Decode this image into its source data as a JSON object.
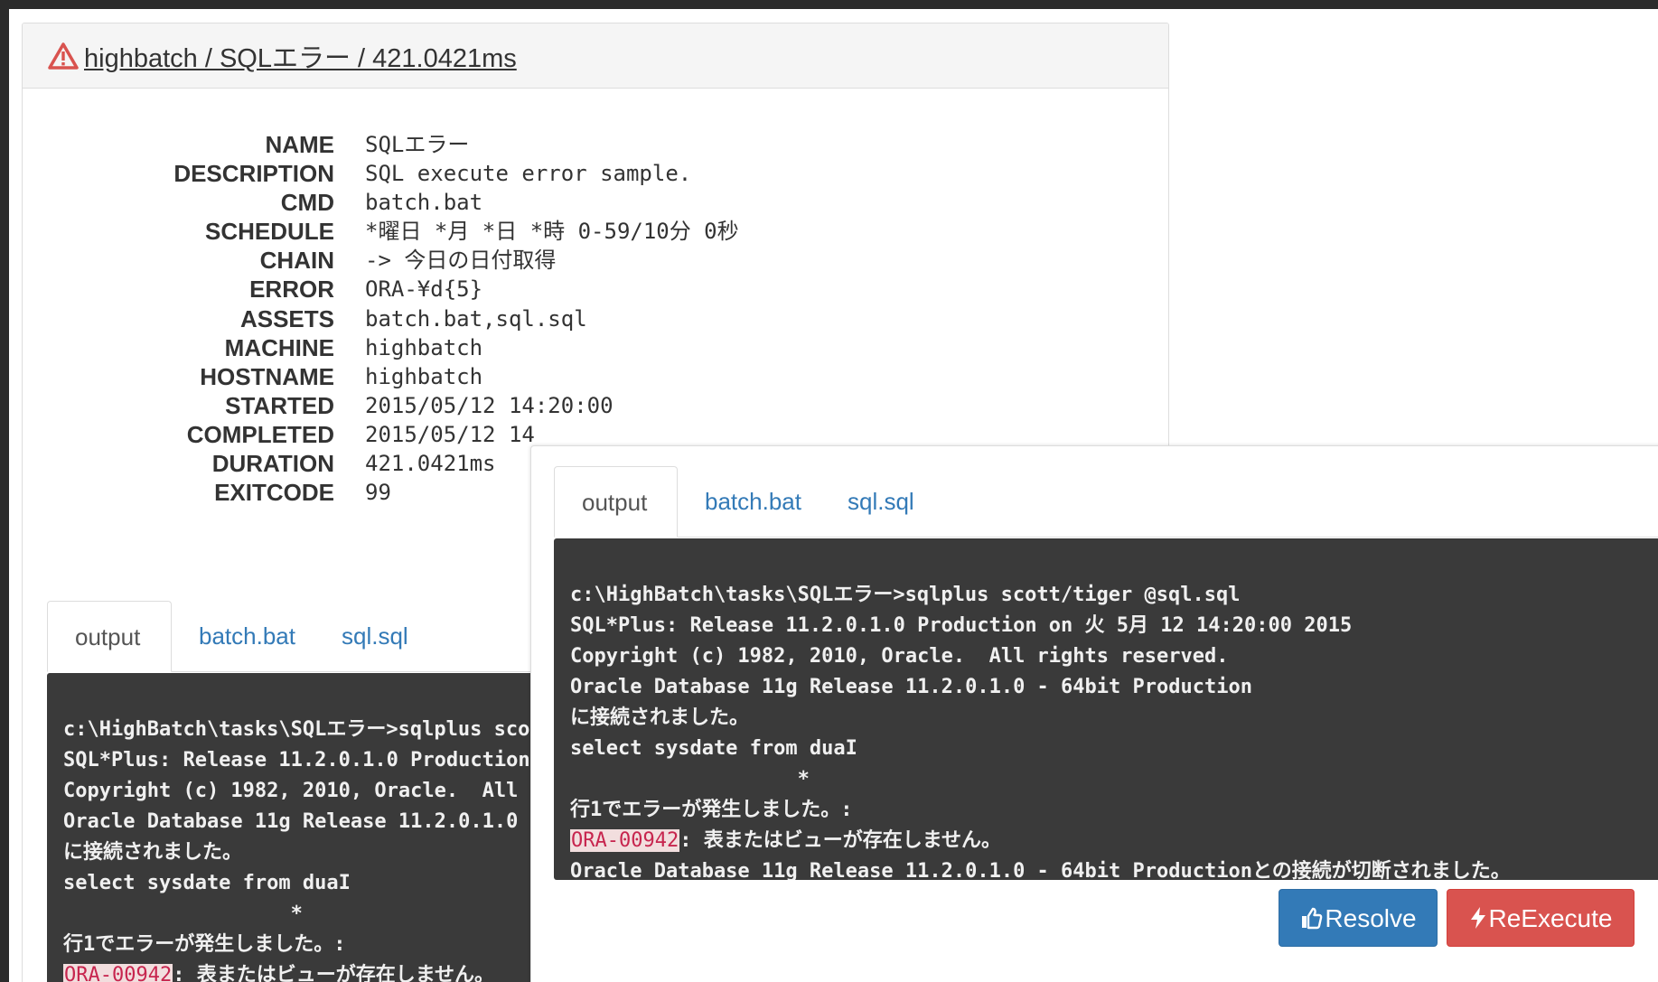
{
  "header": {
    "title": "highbatch / SQLエラー / 421.0421ms",
    "icon": "warning-icon",
    "icon_color": "#d9534f"
  },
  "details": [
    {
      "label": "NAME",
      "value": "SQLエラー"
    },
    {
      "label": "DESCRIPTION",
      "value": "SQL execute error sample."
    },
    {
      "label": "CMD",
      "value": "batch.bat"
    },
    {
      "label": "SCHEDULE",
      "value": "*曜日 *月 *日 *時 0-59/10分 0秒"
    },
    {
      "label": "CHAIN",
      "value": "-> 今日の日付取得"
    },
    {
      "label": "ERROR",
      "value": "ORA-¥d{5}"
    },
    {
      "label": "ASSETS",
      "value": "batch.bat,sql.sql"
    },
    {
      "label": "MACHINE",
      "value": "highbatch"
    },
    {
      "label": "HOSTNAME",
      "value": "highbatch"
    },
    {
      "label": "STARTED",
      "value": "2015/05/12 14:20:00"
    },
    {
      "label": "COMPLETED",
      "value": "2015/05/12 14"
    },
    {
      "label": "DURATION",
      "value": "421.0421ms"
    },
    {
      "label": "EXITCODE",
      "value": "99"
    }
  ],
  "tabs": [
    {
      "label": "output",
      "active": true
    },
    {
      "label": "batch.bat",
      "active": false
    },
    {
      "label": "sql.sql",
      "active": false
    }
  ],
  "console": {
    "lines": [
      "c:\\HighBatch\\tasks\\SQLエラー>sqlplus scott/tiger @sql.sql",
      "SQL*Plus: Release 11.2.0.1.0 Production on 火 5月 12 14:20:00 2015",
      "Copyright (c) 1982, 2010, Oracle.  All rights reserved.",
      "Oracle Database 11g Release 11.2.0.1.0 - 64bit Production",
      "に接続されました。",
      "select sysdate from duaI",
      "                   *",
      "行1でエラーが発生しました。:"
    ],
    "error_code": "ORA-00942",
    "error_message": ": 表またはビューが存在しません。",
    "last_line": "Oracle Database 11g Release 11.2.0.1.0 - 64bit Productionとの接続が切断されました。"
  },
  "actions": {
    "resolve_label": "Resolve",
    "reexecute_label": "ReExecute",
    "resolve_color": "#337ab7",
    "reexecute_color": "#d9534f"
  }
}
